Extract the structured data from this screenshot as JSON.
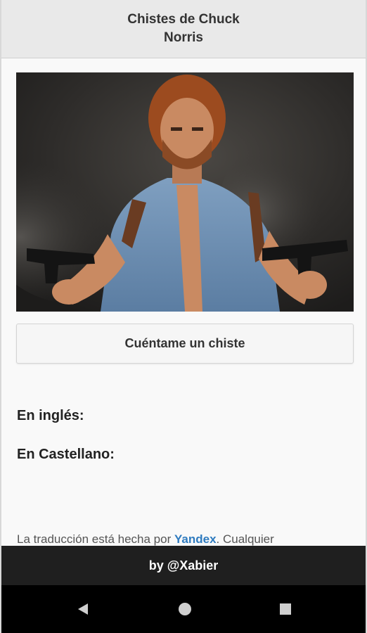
{
  "header": {
    "title": "Chistes de Chuck Norris"
  },
  "hero": {
    "icon": "chuck-norris-photo"
  },
  "actions": {
    "joke_button_label": "Cuéntame un chiste"
  },
  "sections": {
    "english_label": "En inglés:",
    "spanish_label": "En Castellano:"
  },
  "credits": {
    "prefix": "La traducción está hecha por ",
    "link_text": "Yandex",
    "suffix": ". Cualquier"
  },
  "footer": {
    "text": "by @Xabier"
  },
  "colors": {
    "header_bg": "#e9e9e9",
    "footer_bg": "#1f1f1f",
    "link": "#2f7bbf"
  }
}
